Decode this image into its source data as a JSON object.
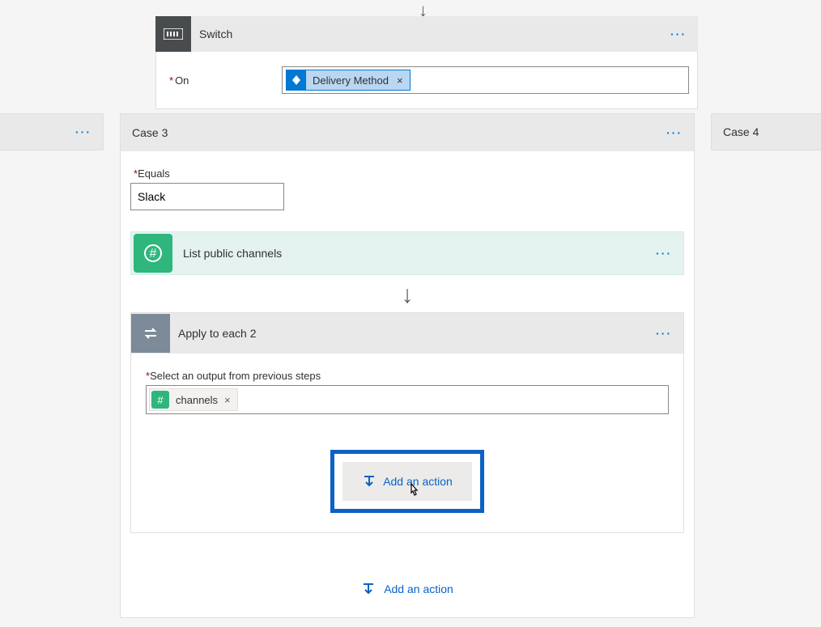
{
  "switch": {
    "title": "Switch",
    "on_label": "On",
    "token": {
      "label": "Delivery Method"
    }
  },
  "case3": {
    "title": "Case 3",
    "equals_label": "Equals",
    "equals_value": "Slack",
    "slack_action": {
      "title": "List public channels"
    },
    "apply": {
      "title": "Apply to each 2",
      "select_label": "Select an output from previous steps",
      "token": {
        "label": "channels"
      },
      "add_action_label": "Add an action"
    },
    "add_action_label": "Add an action"
  },
  "case4": {
    "title": "Case 4"
  }
}
